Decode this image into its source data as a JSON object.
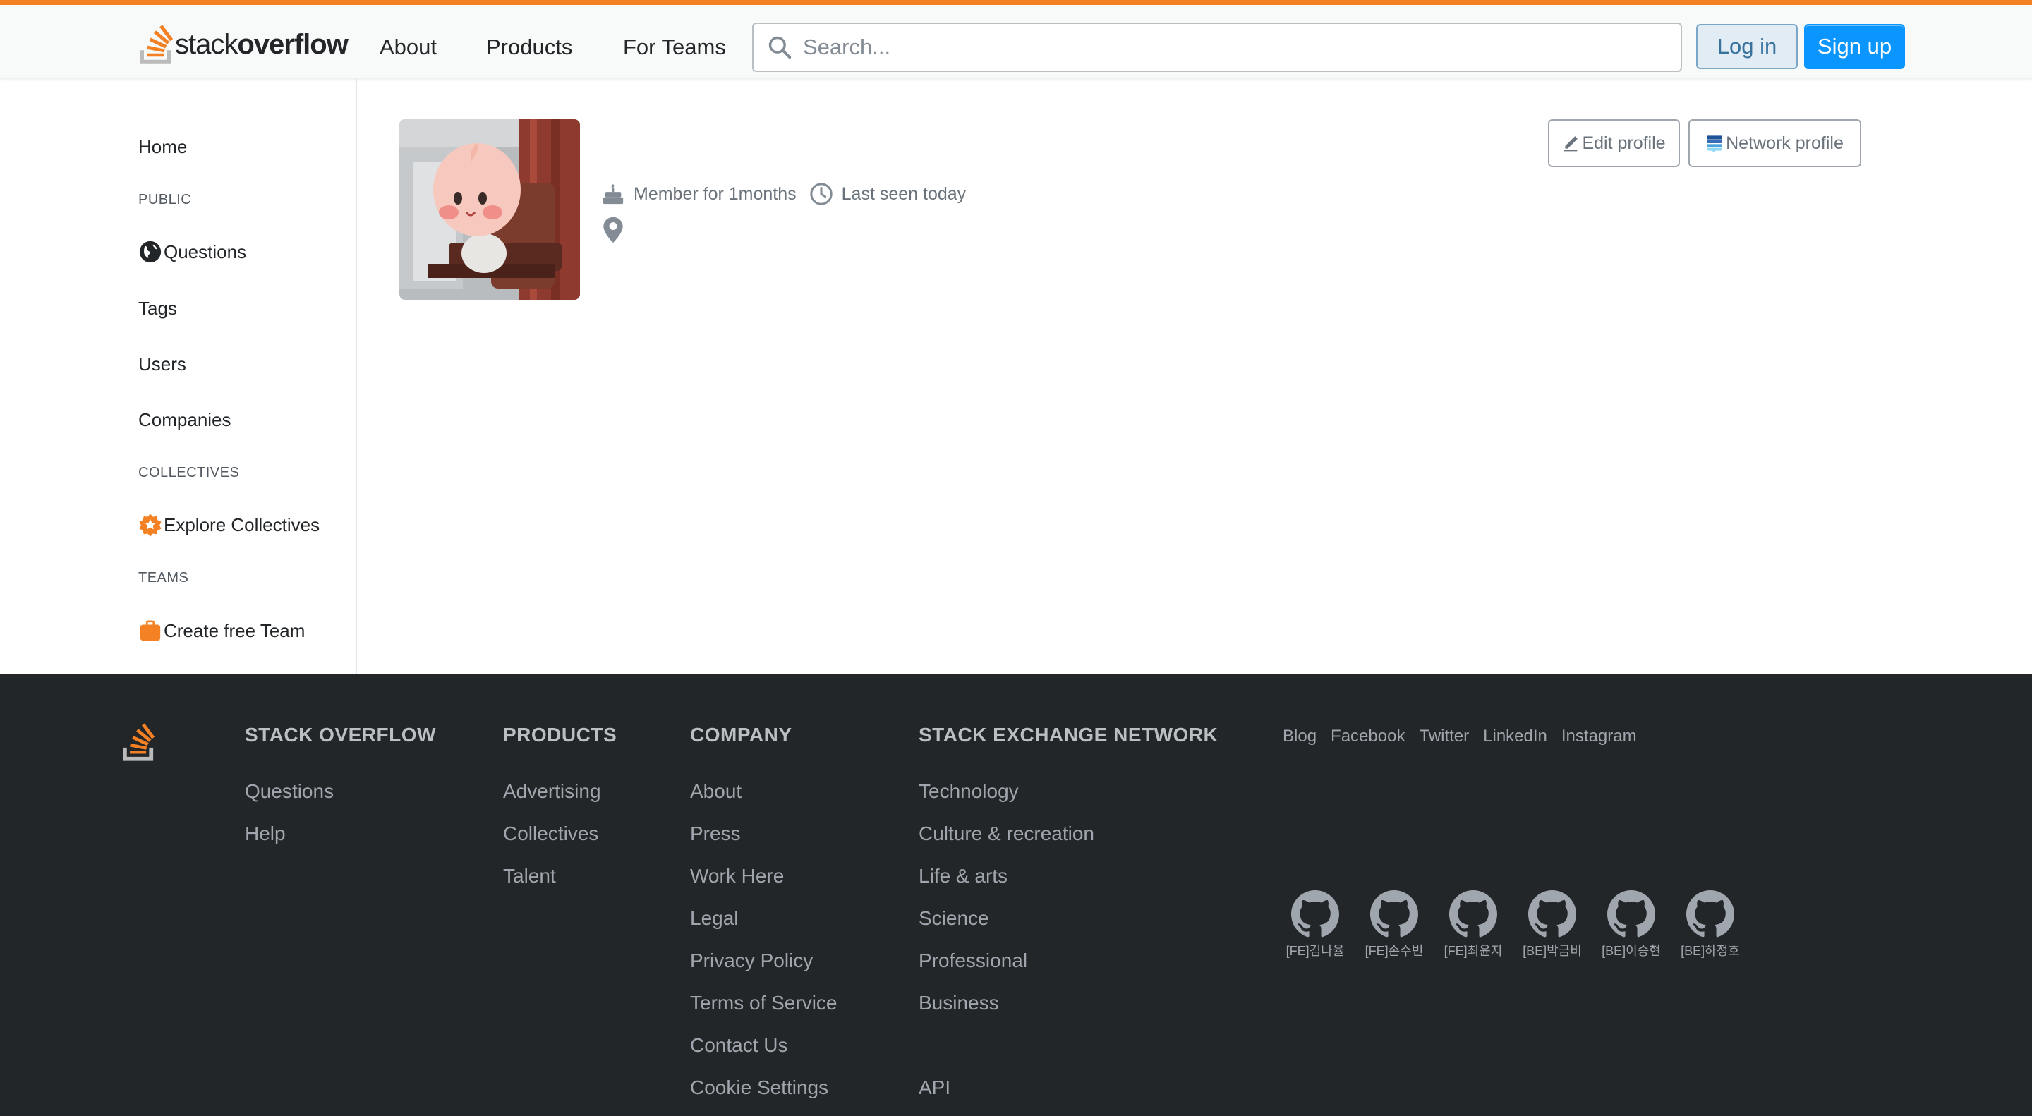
{
  "header": {
    "logo_text_light": "stack",
    "logo_text_bold": "overflow",
    "nav": [
      "About",
      "Products",
      "For Teams"
    ],
    "search_placeholder": "Search...",
    "login_label": "Log in",
    "signup_label": "Sign up",
    "accent_color": "#f48225"
  },
  "sidebar": {
    "home": "Home",
    "public_heading": "PUBLIC",
    "questions": "Questions",
    "tags": "Tags",
    "users": "Users",
    "companies": "Companies",
    "collectives_heading": "COLLECTIVES",
    "explore_collectives": "Explore Collectives",
    "teams_heading": "TEAMS",
    "create_team": "Create free Team"
  },
  "profile": {
    "member_for": "Member for 1months",
    "last_seen": "Last seen today",
    "edit_profile": "Edit profile",
    "network_profile": "Network profile"
  },
  "footer": {
    "columns": [
      {
        "heading": "STACK OVERFLOW",
        "links": [
          "Questions",
          "Help"
        ]
      },
      {
        "heading": "PRODUCTS",
        "links": [
          "Advertising",
          "Collectives",
          "Talent"
        ]
      },
      {
        "heading": "COMPANY",
        "links": [
          "About",
          "Press",
          "Work Here",
          "Legal",
          "Privacy Policy",
          "Terms of Service",
          "Contact Us",
          "Cookie Settings"
        ]
      },
      {
        "heading": "STACK EXCHANGE NETWORK",
        "links": [
          "Technology",
          "Culture & recreation",
          "Life & arts",
          "Science",
          "Professional",
          "Business",
          "",
          "API"
        ]
      }
    ],
    "social": [
      "Blog",
      "Facebook",
      "Twitter",
      "LinkedIn",
      "Instagram"
    ],
    "contributors": [
      "[FE]김나율",
      "[FE]손수빈",
      "[FE]최윤지",
      "[BE]박금비",
      "[BE]이승현",
      "[BE]하정호"
    ]
  }
}
